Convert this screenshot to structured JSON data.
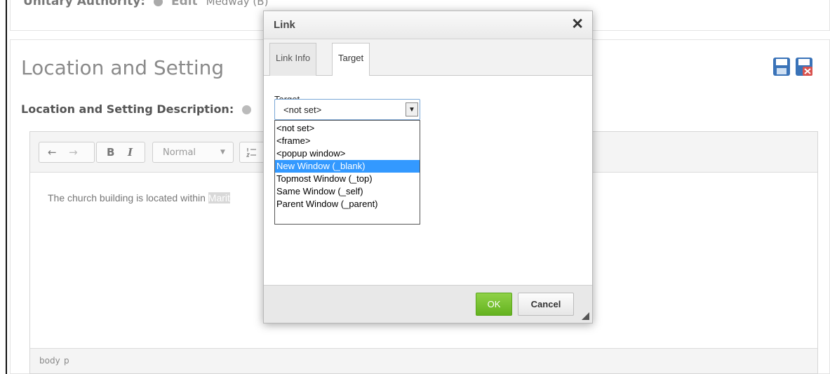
{
  "background": {
    "top_row": {
      "label": "Unitary Authority:",
      "edit_label": "Edit",
      "value": "Medway (B)"
    },
    "section_title": "Location and Setting",
    "description_label": "Location and Setting Description:",
    "toolbar": {
      "undo_label": "←",
      "redo_label": "→",
      "bold_label": "B",
      "italic_label": "I",
      "format_label": "Normal"
    },
    "editor_text": "The church building is located within ",
    "editor_selected_text": "Marit",
    "status_path": [
      "body",
      "p"
    ]
  },
  "dialog": {
    "title": "Link",
    "close_label": "✕",
    "tabs": [
      {
        "label": "Link Info",
        "active": false
      },
      {
        "label": "Target",
        "active": true
      }
    ],
    "target_label": "Target",
    "select_value": "<not set>",
    "options": [
      {
        "label": "<not set>",
        "selected": false
      },
      {
        "label": "<frame>",
        "selected": false
      },
      {
        "label": "<popup window>",
        "selected": false
      },
      {
        "label": "New Window (_blank)",
        "selected": true
      },
      {
        "label": "Topmost Window (_top)",
        "selected": false
      },
      {
        "label": "Same Window (_self)",
        "selected": false
      },
      {
        "label": "Parent Window (_parent)",
        "selected": false
      }
    ],
    "ok_label": "OK",
    "cancel_label": "Cancel"
  },
  "colors": {
    "ok_green": "#64b21f",
    "selected_option": "#3399ff",
    "save_icon": "#3a73b8",
    "cancel_icon": "#d9534f"
  }
}
